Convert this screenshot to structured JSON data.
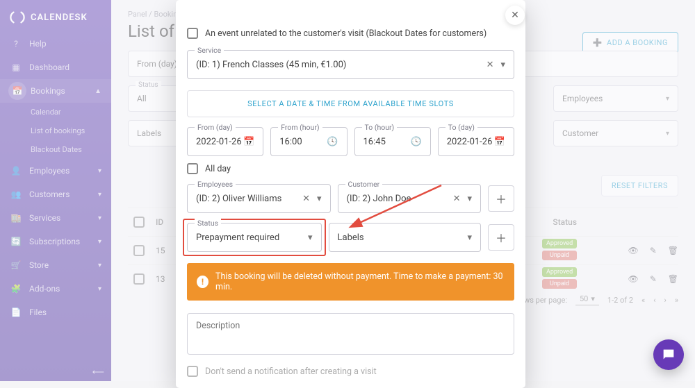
{
  "brand": "CALENDESK",
  "help_label": "HELP",
  "sidebar": {
    "items": [
      {
        "icon": "help",
        "label": "Help"
      },
      {
        "icon": "dashboard",
        "label": "Dashboard"
      },
      {
        "icon": "calendar",
        "label": "Bookings",
        "active": true,
        "expanded": true,
        "sub": [
          {
            "label": "Calendar"
          },
          {
            "label": "List of bookings"
          },
          {
            "label": "Blackout Dates"
          }
        ]
      },
      {
        "icon": "user",
        "label": "Employees"
      },
      {
        "icon": "users",
        "label": "Customers"
      },
      {
        "icon": "store",
        "label": "Services"
      },
      {
        "icon": "refresh",
        "label": "Subscriptions"
      },
      {
        "icon": "cart",
        "label": "Store"
      },
      {
        "icon": "puzzle",
        "label": "Add-ons"
      },
      {
        "icon": "file",
        "label": "Files"
      }
    ]
  },
  "breadcrumb": "Panel / Bookings",
  "page_title": "List of bookings",
  "add_booking_label": "ADD A BOOKING",
  "filters": {
    "from_day_label": "From (day)",
    "status_label": "Status",
    "status_value": "All",
    "employees_label": "Employees",
    "customer_label": "Customer",
    "labels_label": "Labels",
    "reset_label": "RESET FILTERS"
  },
  "table": {
    "head_id": "ID",
    "head_status": "Status",
    "rows": [
      {
        "id": "15",
        "badges": [
          {
            "text": "Approved",
            "cls": "bg-green"
          },
          {
            "text": "Unpaid",
            "cls": "bg-red"
          }
        ]
      },
      {
        "id": "13",
        "badges": [
          {
            "text": "Approved",
            "cls": "bg-green"
          },
          {
            "text": "Unpaid",
            "cls": "bg-red"
          }
        ]
      }
    ]
  },
  "pager": {
    "rows_label": "Rows per page:",
    "size": "50",
    "range": "1-2 of 2"
  },
  "dialog": {
    "unrelated_label": "An event unrelated to the customer's visit (Blackout Dates for customers)",
    "service_label": "Service",
    "service_value": "(ID: 1) French Classes (45 min, €1.00)",
    "slot_button": "SELECT A DATE & TIME FROM AVAILABLE TIME SLOTS",
    "from_day_label": "From (day)",
    "from_day": "2022-01-26",
    "from_hour_label": "From (hour)",
    "from_hour": "16:00",
    "to_hour_label": "To (hour)",
    "to_hour": "16:45",
    "to_day_label": "To (day)",
    "to_day": "2022-01-26",
    "all_day_label": "All day",
    "employees_label": "Employees",
    "employees_value": "(ID: 2) Oliver Williams",
    "customer_label": "Customer",
    "customer_value": "(ID: 2) John Doe",
    "status_label": "Status",
    "status_value": "Prepayment required",
    "labels_label": "Labels",
    "warning": "This booking will be deleted without payment. Time to make a payment: 30 min.",
    "description_placeholder": "Description",
    "no_notify_label": "Don't send a notification after creating a visit"
  }
}
